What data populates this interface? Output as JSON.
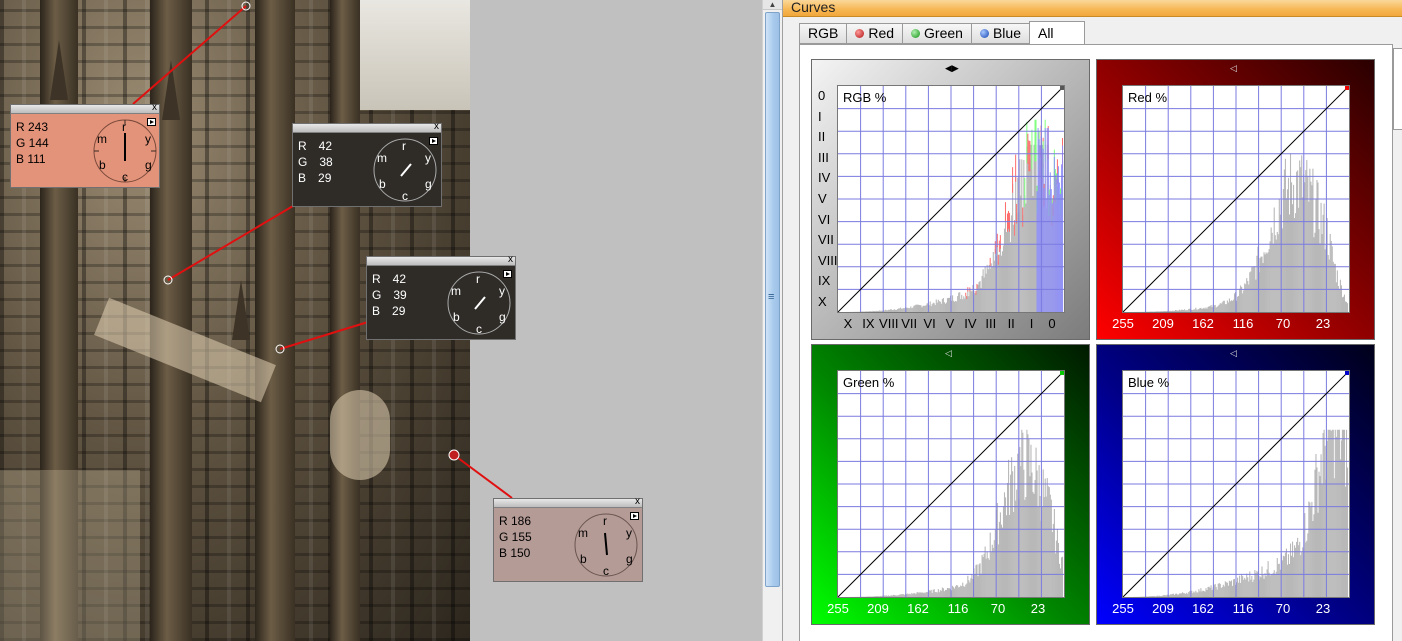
{
  "window_title": "Curves",
  "tabs": [
    {
      "label": "RGB",
      "dot": null,
      "active": false
    },
    {
      "label": "Red",
      "dot": "#cc2222",
      "active": false
    },
    {
      "label": "Green",
      "dot": "#22aa22",
      "active": false
    },
    {
      "label": "Blue",
      "dot": "#2255cc",
      "active": false
    },
    {
      "label": "All",
      "dot": null,
      "active": true
    }
  ],
  "panels": {
    "rgb": {
      "label": "RGB %",
      "x_ticks": [
        "X",
        "IX",
        "VIII",
        "VII",
        "VI",
        "V",
        "IV",
        "III",
        "II",
        "I",
        "0"
      ],
      "y_ticks": [
        "0",
        "I",
        "II",
        "III",
        "IV",
        "V",
        "VI",
        "VII",
        "VIII",
        "IX",
        "X"
      ]
    },
    "red": {
      "label": "Red %",
      "x_ticks": [
        "255",
        "209",
        "162",
        "116",
        "70",
        "23"
      ]
    },
    "green": {
      "label": "Green %",
      "x_ticks": [
        "255",
        "209",
        "162",
        "116",
        "70",
        "23"
      ]
    },
    "blue": {
      "label": "Blue %",
      "x_ticks": [
        "255",
        "209",
        "162",
        "116",
        "70",
        "23"
      ]
    }
  },
  "probes": [
    {
      "r_label": "R 243",
      "g_label": "G 144",
      "b_label": "B 111",
      "color": "#e3937a",
      "dial_hand": "r",
      "close": "x"
    },
    {
      "r_label": "R",
      "r": "42",
      "g_label": "G",
      "g": "38",
      "b_label": "B",
      "b": "29",
      "color": "#2f2c28",
      "close": "x"
    },
    {
      "r_label": "R",
      "r": "42",
      "g_label": "G",
      "g": "39",
      "b_label": "B",
      "b": "29",
      "color": "#2f2c28",
      "close": "x"
    },
    {
      "r_label": "R 186",
      "g_label": "G 155",
      "b_label": "B 150",
      "color": "#b59b96",
      "close": "x"
    }
  ],
  "dial_letters": [
    "r",
    "y",
    "g",
    "c",
    "b",
    "m"
  ],
  "colors": {
    "red_panel": "#cc0000",
    "green_panel": "#00aa00",
    "blue_panel": "#0000aa",
    "grid": "#7a7ae0",
    "histogram": "#b8b8b8",
    "link_line": "#e01010"
  }
}
